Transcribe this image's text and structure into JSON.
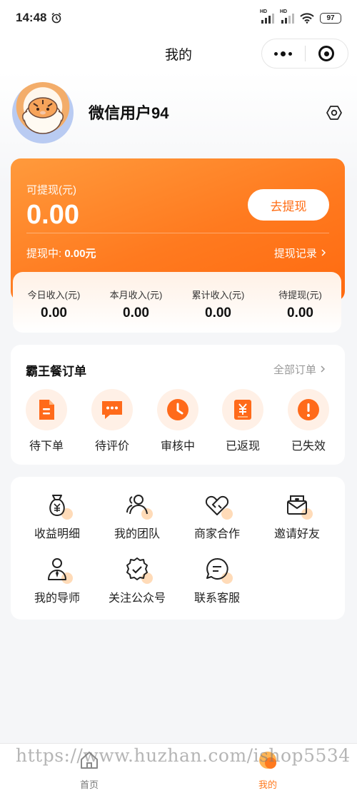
{
  "status_bar": {
    "time": "14:48",
    "battery": "97",
    "signal_tag": "HD"
  },
  "nav": {
    "title": "我的"
  },
  "user": {
    "name": "微信用户94"
  },
  "balance": {
    "label": "可提现(元)",
    "amount": "0.00",
    "withdraw_button": "去提现",
    "pending_label": "提现中:",
    "pending_amount": "0.00元",
    "record_link": "提现记录",
    "stats": [
      {
        "label": "今日收入(元)",
        "value": "0.00"
      },
      {
        "label": "本月收入(元)",
        "value": "0.00"
      },
      {
        "label": "累计收入(元)",
        "value": "0.00"
      },
      {
        "label": "待提现(元)",
        "value": "0.00"
      }
    ]
  },
  "orders": {
    "title": "霸王餐订单",
    "all_link": "全部订单",
    "items": [
      {
        "label": "待下单",
        "icon": "document-icon"
      },
      {
        "label": "待评价",
        "icon": "comment-icon"
      },
      {
        "label": "审核中",
        "icon": "clock-icon"
      },
      {
        "label": "已返现",
        "icon": "yuan-receipt-icon"
      },
      {
        "label": "已失效",
        "icon": "alert-icon"
      }
    ]
  },
  "services": {
    "items": [
      {
        "label": "收益明细",
        "icon": "money-bag-icon"
      },
      {
        "label": "我的团队",
        "icon": "team-icon"
      },
      {
        "label": "商家合作",
        "icon": "handshake-heart-icon"
      },
      {
        "label": "邀请好友",
        "icon": "invite-letter-icon"
      },
      {
        "label": "我的导师",
        "icon": "mentor-icon"
      },
      {
        "label": "关注公众号",
        "icon": "verified-badge-icon"
      },
      {
        "label": "联系客服",
        "icon": "chat-icon"
      }
    ]
  },
  "tabbar": {
    "home": "首页",
    "mine": "我的"
  },
  "watermark": "https://www.huzhan.com/ishop5534",
  "colors": {
    "accent": "#ff7a1f",
    "background": "#f5f6f8"
  }
}
